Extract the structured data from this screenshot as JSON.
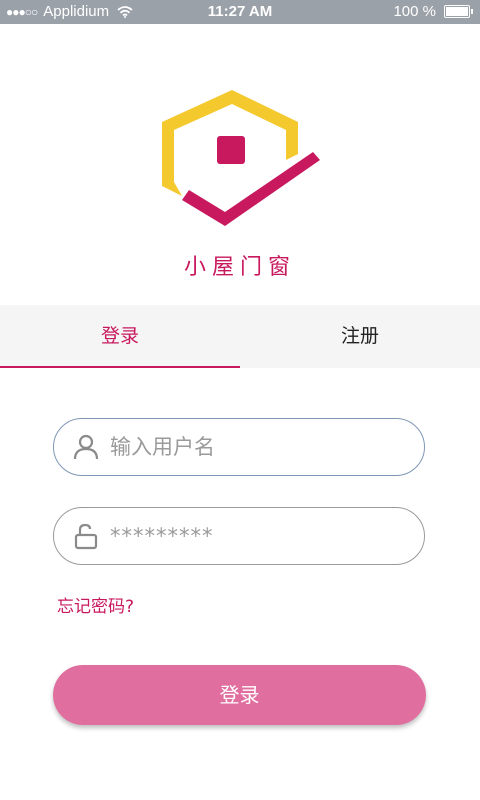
{
  "status_bar": {
    "signal": "●●●○○",
    "carrier": "Applidium",
    "time": "11:27 AM",
    "battery": "100 %"
  },
  "logo": {
    "icon": "house-check-logo",
    "colors": {
      "yellow": "#f4c92d",
      "magenta": "#c8185e"
    }
  },
  "brand": {
    "name": "小屋门窗"
  },
  "tabs": [
    {
      "label": "登录",
      "active": true
    },
    {
      "label": "注册",
      "active": false
    }
  ],
  "form": {
    "username": {
      "placeholder": "输入用户名",
      "value": "",
      "icon": "user-icon"
    },
    "password": {
      "placeholder": "*********",
      "value": "",
      "icon": "unlock-icon"
    },
    "forgot_label": "忘记密码?",
    "submit_label": "登录"
  },
  "colors": {
    "accent": "#c8185e",
    "button": "#e06f9f",
    "tab_background": "#f5f5f5",
    "status_bar": "#9ba1a8"
  }
}
